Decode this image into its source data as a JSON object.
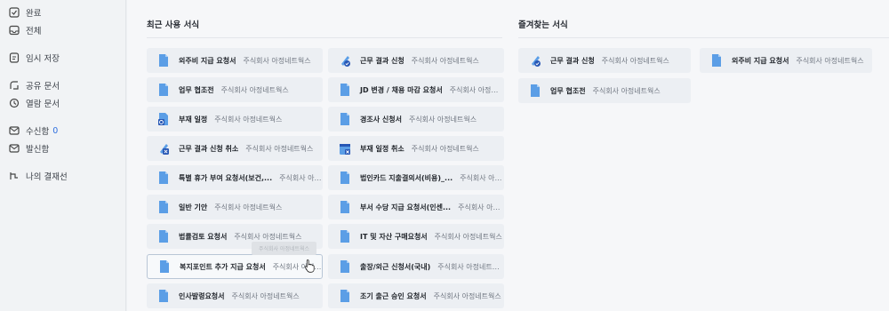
{
  "sidebar": {
    "items": [
      {
        "label": "완료",
        "icon": "check-square-icon",
        "count": ""
      },
      {
        "label": "전체",
        "icon": "inbox-icon",
        "count": ""
      },
      {
        "label": "임시 저장",
        "icon": "save-icon",
        "count": ""
      },
      {
        "label": "공유 문서",
        "icon": "share-icon",
        "count": ""
      },
      {
        "label": "열람 문서",
        "icon": "eye-icon",
        "count": ""
      },
      {
        "label": "수신함",
        "icon": "mail-icon",
        "count": "0"
      },
      {
        "label": "발신함",
        "icon": "outbox-icon",
        "count": ""
      },
      {
        "label": "나의 결재선",
        "icon": "approval-line-icon",
        "count": ""
      }
    ]
  },
  "recent": {
    "title": "최근 사용 서식",
    "col1": [
      {
        "name": "외주비 지급 요청서",
        "org": "주식회사 아정네트웍스",
        "icon": "doc"
      },
      {
        "name": "업무 협조전",
        "org": "주식회사 아정네트웍스",
        "icon": "doc"
      },
      {
        "name": "부재 일정",
        "org": "주식회사 아정네트웍스",
        "icon": "calendar"
      },
      {
        "name": "근무 결과 신청 취소",
        "org": "주식회사 아정네트웍스",
        "icon": "cancel"
      },
      {
        "name": "특별 휴가 부여 요청서(보건,...",
        "org": "주식회사 아정네...",
        "icon": "doc"
      },
      {
        "name": "일반 기안",
        "org": "주식회사 아정네트웍스",
        "icon": "doc"
      },
      {
        "name": "법률검토 요청서",
        "org": "주식회사 아정네트웍스",
        "icon": "doc"
      },
      {
        "name": "복지포인트 추가 지급 요청서",
        "org": "주식회사 아정네트...",
        "icon": "doc"
      },
      {
        "name": "인사발령요청서",
        "org": "주식회사 아정네트웍스",
        "icon": "doc"
      }
    ],
    "col2": [
      {
        "name": "근무 결과 신청",
        "org": "주식회사 아정네트웍스",
        "icon": "check"
      },
      {
        "name": "JD 변경 / 채용 마감 요청서",
        "org": "주식회사 아정네트웍스",
        "icon": "doc"
      },
      {
        "name": "경조사 신청서",
        "org": "주식회사 아정네트웍스",
        "icon": "doc"
      },
      {
        "name": "부재 일정 취소",
        "org": "주식회사 아정네트웍스",
        "icon": "calendar-x"
      },
      {
        "name": "법인카드 지출결의서(비용)_...",
        "org": "주식회사 아정네...",
        "icon": "doc"
      },
      {
        "name": "부서 수당 지급 요청서(인센...",
        "org": "주식회사 아정네...",
        "icon": "doc"
      },
      {
        "name": "IT 및 자산 구매요청서",
        "org": "주식회사 아정네트웍스",
        "icon": "doc"
      },
      {
        "name": "출장/외근 신청서(국내)",
        "org": "주식회사 아정네트웍스",
        "icon": "doc"
      },
      {
        "name": "조기 출근 승인 요청서",
        "org": "주식회사 아정네트웍스",
        "icon": "doc"
      }
    ]
  },
  "favorites": {
    "title": "즐겨찾는 서식",
    "items": [
      {
        "name": "근무 결과 신청",
        "org": "주식회사 아정네트웍스",
        "icon": "check"
      },
      {
        "name": "외주비 지급 요청서",
        "org": "주식회사 아정네트웍스",
        "icon": "doc"
      },
      {
        "name": "업무 협조전",
        "org": "주식회사 아정네트웍스",
        "icon": "doc"
      }
    ]
  },
  "tooltip": "주식회사 아정네트웍스",
  "colors": {
    "accent": "#2f6fde",
    "doc_icon": "#5b9ee6"
  }
}
